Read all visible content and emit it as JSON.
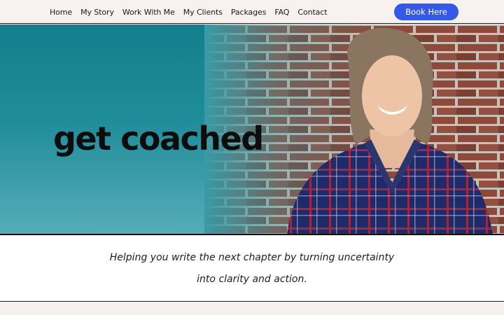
{
  "nav": {
    "links": [
      "Home",
      "My Story",
      "Work With Me",
      "My Clients",
      "Packages",
      "FAQ",
      "Contact"
    ],
    "cta_label": "Book Here"
  },
  "hero": {
    "title": "get coached",
    "photo_icon": "portrait-photo"
  },
  "tagline": {
    "line1": "Helping you write the next chapter by turning uncertainty",
    "line2": "into clarity and action."
  },
  "colors": {
    "accent": "#3459e6",
    "hero_teal": "#12808c",
    "nav_bg": "#f7f2ef"
  }
}
